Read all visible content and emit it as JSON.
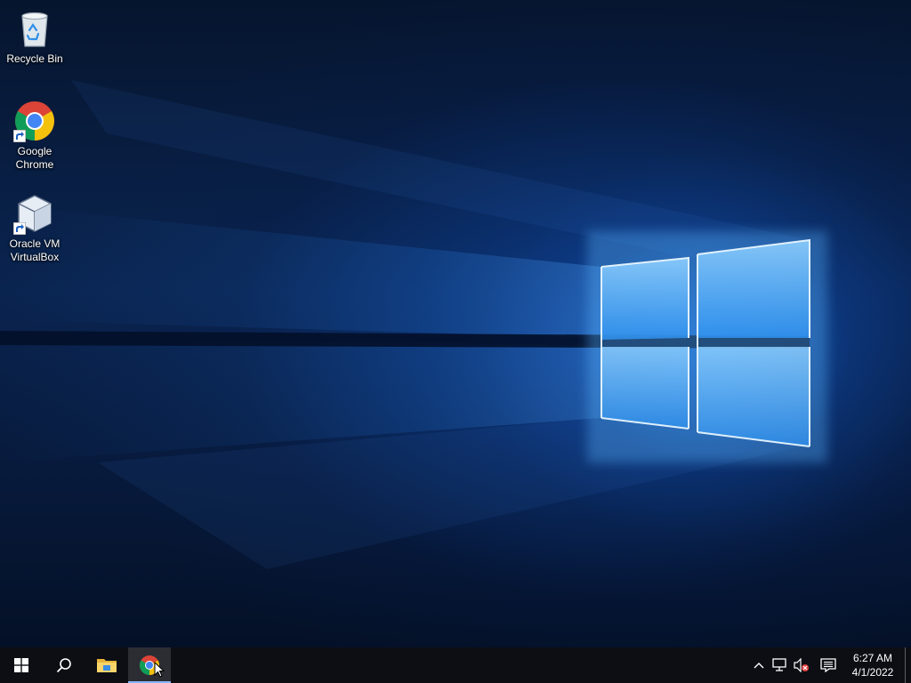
{
  "desktop": {
    "wallpaper": "windows-10-hero",
    "icons": [
      {
        "label": "Recycle Bin",
        "icon": "recycle-bin-icon"
      },
      {
        "label": "Google\nChrome",
        "icon": "chrome-icon",
        "shortcut": true
      },
      {
        "label": "Oracle VM\nVirtualBox",
        "icon": "virtualbox-icon",
        "shortcut": true
      }
    ]
  },
  "taskbar": {
    "pinned": [
      {
        "name": "start",
        "icon": "windows-logo-icon"
      },
      {
        "name": "search",
        "icon": "search-icon"
      },
      {
        "name": "file-explorer",
        "icon": "folder-icon"
      },
      {
        "name": "google-chrome",
        "icon": "chrome-icon",
        "active": true
      }
    ],
    "tray": {
      "icons": [
        "chevron-up-icon",
        "network-icon",
        "volume-muted-icon",
        "action-center-icon"
      ],
      "time": "6:27 AM",
      "date": "4/1/2022"
    },
    "accent": "#8ab4f8"
  }
}
